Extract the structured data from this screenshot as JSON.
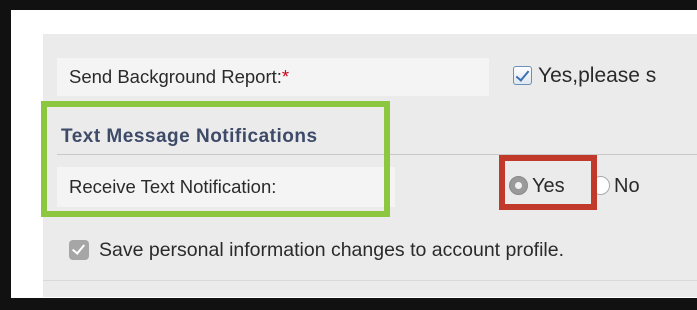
{
  "background_report": {
    "label": "Send Background Report:",
    "required_mark": "*",
    "checkbox_checked": true,
    "option_text": "Yes,please s"
  },
  "text_notifications": {
    "section_title": "Text Message Notifications",
    "field_label": "Receive Text Notification:",
    "options": [
      {
        "label": "Yes",
        "selected": true
      },
      {
        "label": "No",
        "selected": false
      }
    ]
  },
  "save_profile": {
    "checked": true,
    "label": "Save personal information changes to account profile."
  },
  "highlights": {
    "green_color": "#8dc63f",
    "red_color": "#c0392b"
  }
}
